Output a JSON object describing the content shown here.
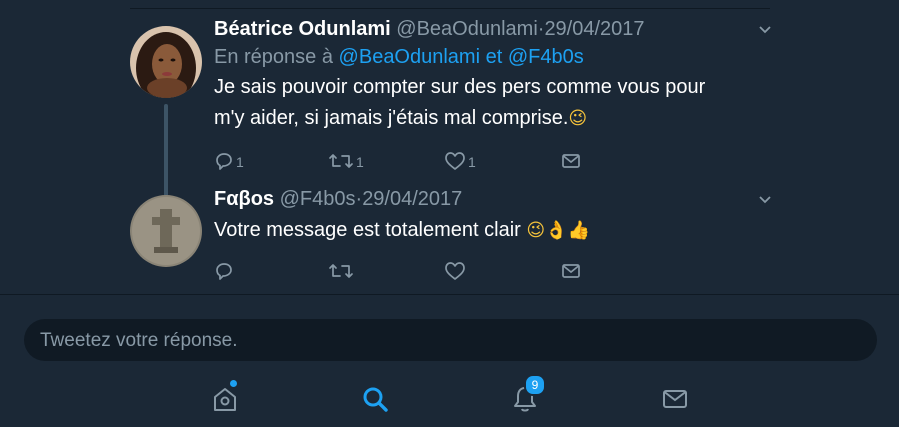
{
  "tweets": [
    {
      "name": "Béatrice Odunlami",
      "handle": "@BeaOdunlami",
      "separator": "·",
      "date": "29/04/2017",
      "reply_prefix": "En réponse à",
      "reply_to_1": "@BeaOdunlami",
      "reply_and": "et",
      "reply_to_2": "@F4b0s",
      "text_line1": "Je sais pouvoir compter sur des pers comme vous pour",
      "text_line2": "m'y aider, si jamais j'étais mal comprise.",
      "emoji": "😉",
      "reply_count": "1",
      "retweet_count": "1",
      "like_count": "1"
    },
    {
      "name": "Fαβos",
      "handle": "@F4b0s",
      "separator": "·",
      "date": "29/04/2017",
      "text": "Votre message est totalement clair",
      "emoji": "😉👌👍",
      "reply_count": "",
      "retweet_count": "",
      "like_count": ""
    }
  ],
  "reply_box": {
    "placeholder": "Tweetez votre réponse."
  },
  "tabbar": {
    "notifications_badge": "9"
  },
  "colors": {
    "background": "#1b2836",
    "accent": "#1da1f2",
    "muted": "#8899a6"
  },
  "icons": [
    "chevron-down-icon",
    "reply-icon",
    "retweet-icon",
    "like-icon",
    "dm-icon",
    "home-icon",
    "search-icon",
    "bell-icon",
    "mail-icon"
  ]
}
